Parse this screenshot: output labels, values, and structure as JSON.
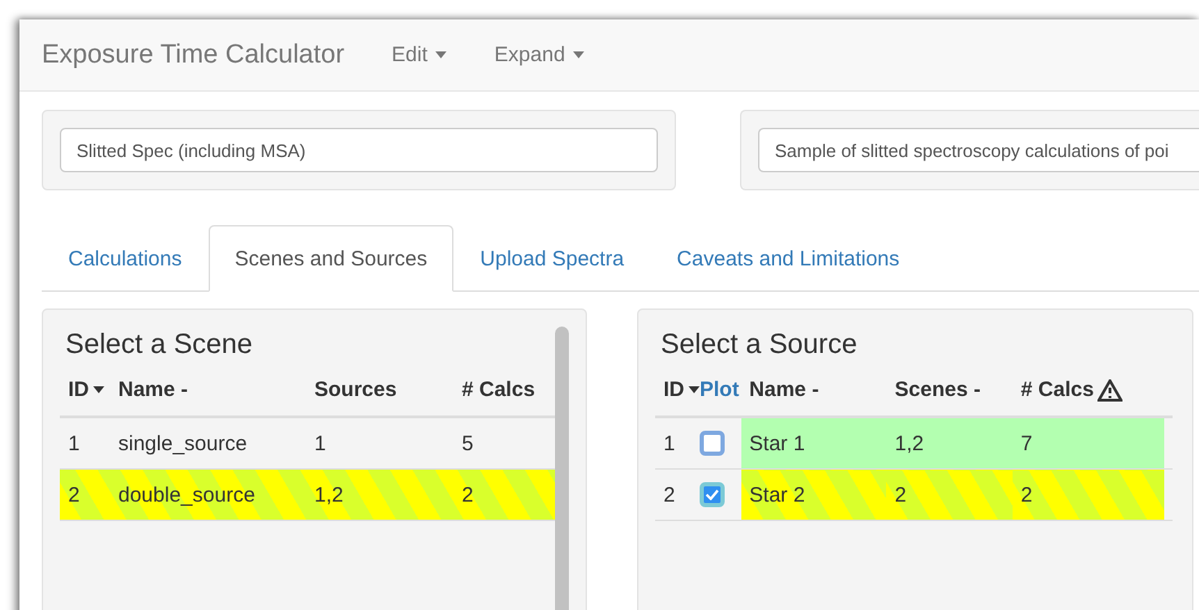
{
  "app": {
    "title": "Exposure Time Calculator",
    "menus": [
      {
        "label": "Edit"
      },
      {
        "label": "Expand"
      }
    ]
  },
  "workbook": {
    "name": "Slitted Spec (including MSA)",
    "description": "Sample of slitted spectroscopy calculations of poi"
  },
  "tabs": [
    {
      "label": "Calculations",
      "selected": false
    },
    {
      "label": "Scenes and Sources",
      "selected": true
    },
    {
      "label": "Upload Spectra",
      "selected": false
    },
    {
      "label": "Caveats and Limitations",
      "selected": false
    }
  ],
  "scenes": {
    "title": "Select a Scene",
    "columns": [
      "ID",
      "Name -",
      "Sources",
      "# Calcs"
    ],
    "rows": [
      {
        "id": "1",
        "name": "single_source",
        "sources": "1",
        "calcs": "5",
        "selected": false
      },
      {
        "id": "2",
        "name": "double_source",
        "sources": "1,2",
        "calcs": "2",
        "selected": true
      }
    ]
  },
  "sources": {
    "title": "Select a Source",
    "columns": [
      "ID",
      "Plot",
      "Name -",
      "Scenes -",
      "# Calcs"
    ],
    "rows": [
      {
        "id": "1",
        "plot": false,
        "name": "Star 1",
        "scenes": "1,2",
        "calcs": "7",
        "selected": false,
        "in_scene": true
      },
      {
        "id": "2",
        "plot": true,
        "name": "Star 2",
        "scenes": "2",
        "calcs": "2",
        "selected": true,
        "in_scene": true
      }
    ]
  }
}
